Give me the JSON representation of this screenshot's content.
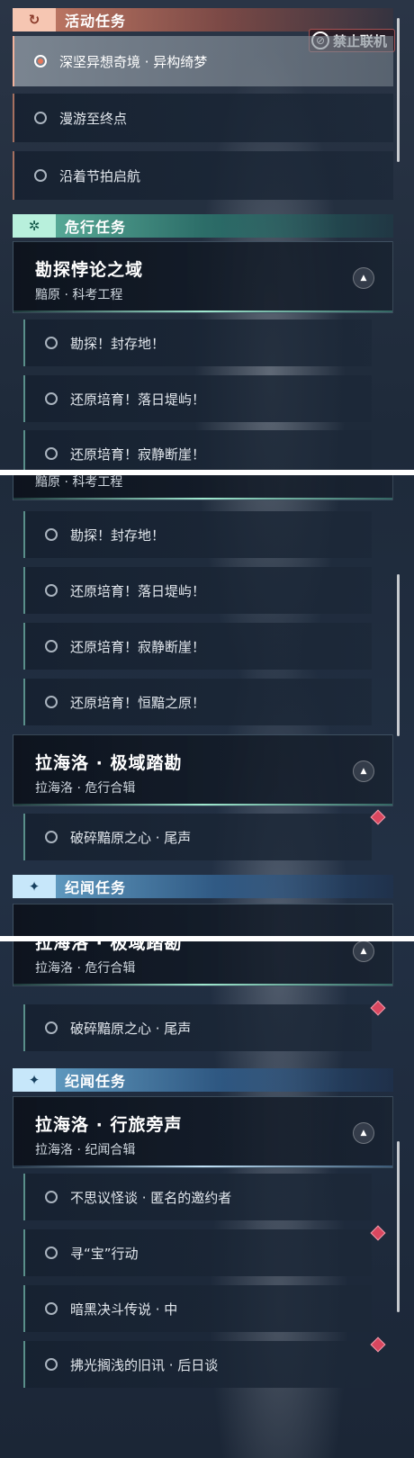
{
  "activity": {
    "header_title": "活动任务",
    "header_icon": "return-arrow-icon",
    "offline_badge": "禁止联机",
    "quests": [
      "深坚异想奇境 · 异构绮梦",
      "漫游至终点",
      "沿着节拍启航"
    ]
  },
  "danger": {
    "header_title": "危行任务",
    "header_icon": "gear-icon",
    "group1": {
      "title": "勘探悖论之域",
      "subtitle": "黯原 · 科考工程",
      "quests": [
        "勘探！封存地！",
        "还原培育！落日堤屿！",
        "还原培育！寂静断崖！",
        "还原培育！恒黯之原！"
      ]
    },
    "group2": {
      "title": "拉海洛 · 极域踏勘",
      "subtitle": "拉海洛 · 危行合辑",
      "quests": [
        "破碎黯原之心 · 尾声"
      ]
    }
  },
  "story": {
    "header_title": "纪闻任务",
    "header_icon": "sparkle-icon",
    "group1": {
      "title": "拉海洛 · 行旅旁声",
      "subtitle": "拉海洛 · 纪闻合辑",
      "quests": [
        "不思议怪谈 · 匿名的邀约者",
        "寻“宝”行动",
        "暗黑决斗传说 · 中",
        "拂光搁浅的旧讯 · 后日谈"
      ]
    }
  },
  "colors": {
    "activity_accent": "#e88a6e",
    "danger_accent": "#6fd2b4",
    "story_accent": "#7bbce6",
    "marker": "#d9475f"
  }
}
